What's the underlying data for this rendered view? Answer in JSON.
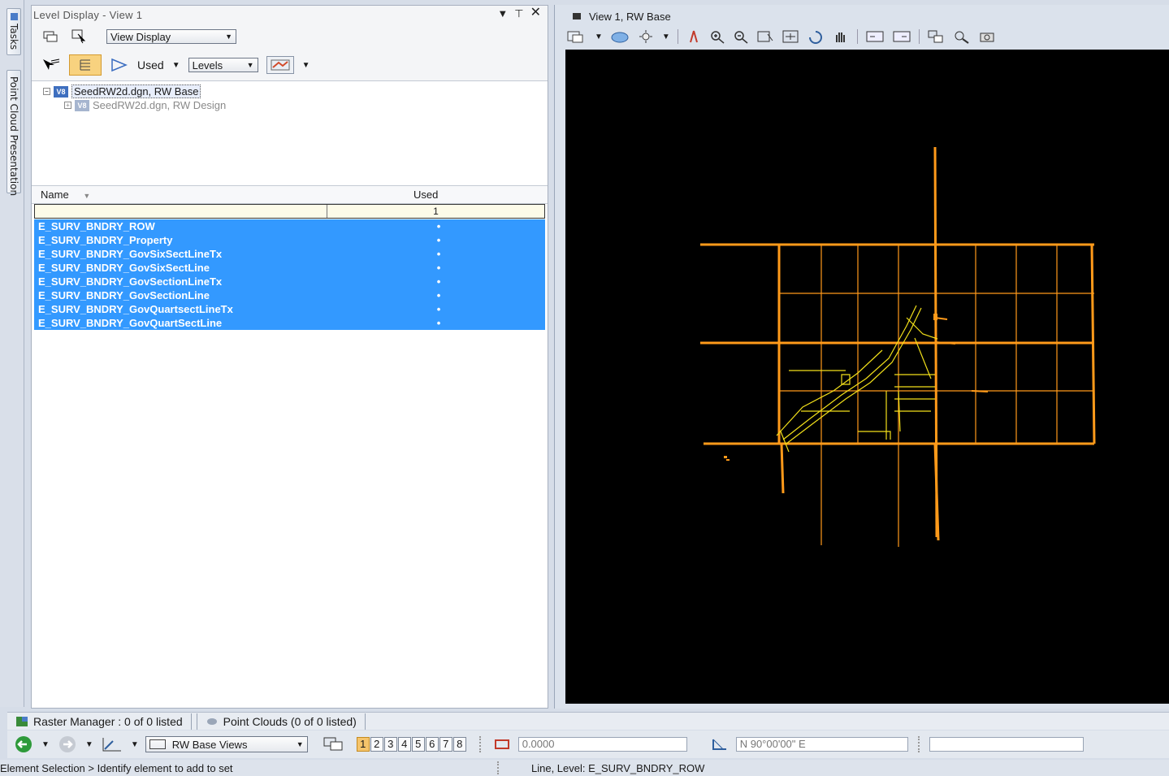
{
  "side_tabs": {
    "tasks": "Tasks",
    "point_cloud": "Point Cloud Presentation"
  },
  "panel": {
    "title": "Level Display - View 1",
    "view_combo": "View Display",
    "used_label": "Used",
    "levels_combo": "Levels",
    "tree": [
      {
        "label": "SeedRW2d.dgn, RW Base",
        "active": true
      },
      {
        "label": "SeedRW2d.dgn, RW Design",
        "active": false
      }
    ],
    "columns": {
      "name": "Name",
      "used": "Used"
    },
    "filter_used": "1",
    "rows": [
      {
        "name": "E_SURV_BNDRY_ROW",
        "used": "•"
      },
      {
        "name": "E_SURV_BNDRY_Property",
        "used": "•"
      },
      {
        "name": "E_SURV_BNDRY_GovSixSectLineTx",
        "used": "•"
      },
      {
        "name": "E_SURV_BNDRY_GovSixSectLine",
        "used": "•"
      },
      {
        "name": "E_SURV_BNDRY_GovSectionLineTx",
        "used": "•"
      },
      {
        "name": "E_SURV_BNDRY_GovSectionLine",
        "used": "•"
      },
      {
        "name": "E_SURV_BNDRY_GovQuartsectLineTx",
        "used": "•"
      },
      {
        "name": "E_SURV_BNDRY_GovQuartSectLine",
        "used": "•"
      }
    ]
  },
  "view": {
    "title": "View 1, RW Base"
  },
  "bottom_tabs": {
    "raster": "Raster Manager : 0 of 0 listed",
    "point_clouds": "Point Clouds (0 of 0 listed)"
  },
  "toolbar": {
    "views_combo": "RW Base Views",
    "view_numbers": [
      "1",
      "2",
      "3",
      "4",
      "5",
      "6",
      "7",
      "8"
    ],
    "distance": "0.0000",
    "bearing": "N 90°00'00\" E"
  },
  "status": {
    "prompt": "Element Selection > Identify element to add to set",
    "info": "Line, Level: E_SURV_BNDRY_ROW"
  },
  "colors": {
    "selection": "#3399ff",
    "orange": "#ff9a1a",
    "yellow": "#f2e01a"
  }
}
